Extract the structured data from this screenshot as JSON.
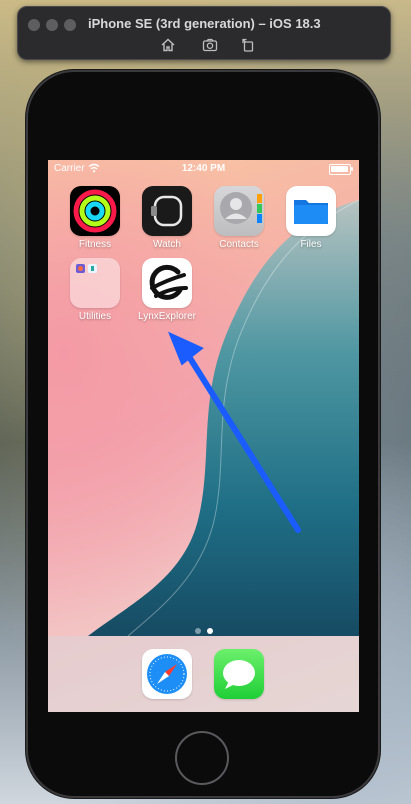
{
  "simulator": {
    "title": "iPhone SE (3rd generation) – iOS 18.3",
    "toolbar": [
      {
        "icon": "home-icon"
      },
      {
        "icon": "screenshot-icon"
      },
      {
        "icon": "rotate-icon"
      }
    ]
  },
  "status_bar": {
    "carrier": "Carrier",
    "time": "12:40 PM",
    "wifi_icon": "wifi-icon",
    "battery_icon": "battery-icon"
  },
  "apps": [
    {
      "id": "fitness",
      "label": "Fitness",
      "icon": "fitness-rings-icon"
    },
    {
      "id": "watch",
      "label": "Watch",
      "icon": "watch-icon"
    },
    {
      "id": "contacts",
      "label": "Contacts",
      "icon": "contacts-icon"
    },
    {
      "id": "files",
      "label": "Files",
      "icon": "folder-icon"
    },
    {
      "id": "utilities",
      "label": "Utilities",
      "icon": "folder-icon"
    },
    {
      "id": "lynx",
      "label": "LynxExplorer",
      "icon": "lynx-logo-icon"
    }
  ],
  "page_indicator": {
    "pages": 2,
    "current": 2
  },
  "dock": [
    {
      "id": "safari",
      "icon": "safari-compass-icon"
    },
    {
      "id": "messages",
      "icon": "messages-bubble-icon"
    }
  ],
  "annotation": {
    "type": "arrow",
    "color": "#1a5cff",
    "target": "lynx"
  },
  "colors": {
    "arrow": "#1a5cff",
    "files_blue": "#1e8cf5",
    "messages_green": "#29d43f",
    "wallpaper_teal": "#1f6f86"
  }
}
